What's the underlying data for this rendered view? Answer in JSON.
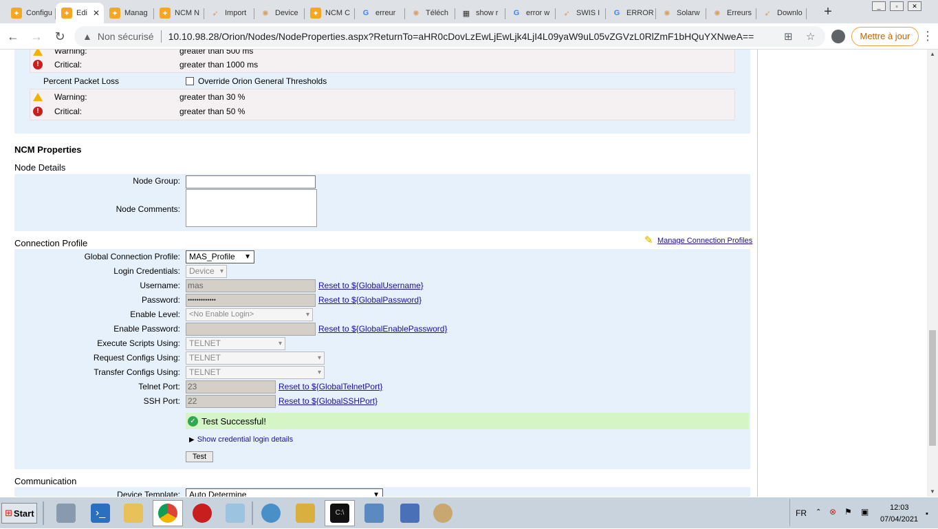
{
  "browser": {
    "tabs": [
      {
        "label": "Configu",
        "icon": "solarwinds-icon"
      },
      {
        "label": "Edi",
        "icon": "solarwinds-icon",
        "active": true
      },
      {
        "label": "Manag",
        "icon": "solarwinds-icon"
      },
      {
        "label": "NCM N",
        "icon": "solarwinds-icon"
      },
      {
        "label": "Import",
        "icon": "solarwinds-bird-icon"
      },
      {
        "label": "Device",
        "icon": "brain-icon"
      },
      {
        "label": "NCM C",
        "icon": "solarwinds-icon"
      },
      {
        "label": "erreur",
        "icon": "google-icon"
      },
      {
        "label": "Téléch",
        "icon": "brain-icon"
      },
      {
        "label": "show r",
        "icon": "cisco-icon"
      },
      {
        "label": "error w",
        "icon": "google-icon"
      },
      {
        "label": "SWIS I",
        "icon": "solarwinds-bird-icon"
      },
      {
        "label": "ERROR",
        "icon": "google-icon"
      },
      {
        "label": "Solarw",
        "icon": "brain-icon"
      },
      {
        "label": "Erreurs",
        "icon": "brain-icon"
      },
      {
        "label": "Downlo",
        "icon": "solarwinds-bird-icon"
      }
    ],
    "new_tab": "+",
    "security_label": "Non sécurisé",
    "url": "10.10.98.28/Orion/Nodes/NodeProperties.aspx?ReturnTo=aHR0cDovLzEwLjEwLjk4LjI4L09yaW9uL05vZGVzL0RlZmF1bHQuYXNweA==",
    "update_label": "Mettre à jour"
  },
  "thresholds": {
    "response_warning_label": "Warning:",
    "response_warning_value": "greater than 500 ms",
    "response_critical_label": "Critical:",
    "response_critical_value": "greater than 1000 ms",
    "packet_loss_label": "Percent Packet Loss",
    "override_label": "Override Orion General Thresholds",
    "pl_warning_label": "Warning:",
    "pl_warning_value": "greater than 30 %",
    "pl_critical_label": "Critical:",
    "pl_critical_value": "greater than 50 %"
  },
  "ncm": {
    "title": "NCM Properties",
    "node_details_title": "Node Details",
    "node_group_label": "Node Group:",
    "node_group_value": "",
    "node_comments_label": "Node Comments:",
    "connection_profile_title": "Connection Profile",
    "manage_profiles_link": "Manage Connection Profiles",
    "fields": {
      "global_profile_label": "Global Connection Profile:",
      "global_profile_value": "MAS_Profile",
      "login_credentials_label": "Login Credentials:",
      "login_credentials_value": "Device",
      "username_label": "Username:",
      "username_value": "mas",
      "username_reset": "Reset to ${GlobalUsername}",
      "password_label": "Password:",
      "password_value": "•••••••••••••",
      "password_reset": "Reset to ${GlobalPassword}",
      "enable_level_label": "Enable Level:",
      "enable_level_value": "<No Enable Login>",
      "enable_password_label": "Enable Password:",
      "enable_password_reset": "Reset to ${GlobalEnablePassword}",
      "exec_scripts_label": "Execute Scripts Using:",
      "exec_scripts_value": "TELNET",
      "request_configs_label": "Request Configs Using:",
      "request_configs_value": "TELNET",
      "transfer_configs_label": "Transfer Configs Using:",
      "transfer_configs_value": "TELNET",
      "telnet_port_label": "Telnet Port:",
      "telnet_port_value": "23",
      "telnet_port_reset": "Reset to ${GlobalTelnetPort}",
      "ssh_port_label": "SSH Port:",
      "ssh_port_value": "22",
      "ssh_port_reset": "Reset to ${GlobalSSHPort}"
    },
    "test_result": "Test Successful!",
    "show_details": "Show credential login details",
    "test_button": "Test",
    "communication_title": "Communication",
    "device_template_label": "Device Template:",
    "device_template_value": "Auto Determine"
  },
  "taskbar": {
    "start_label": "Start",
    "language": "FR",
    "time": "12:03",
    "date": "07/04/2021"
  }
}
